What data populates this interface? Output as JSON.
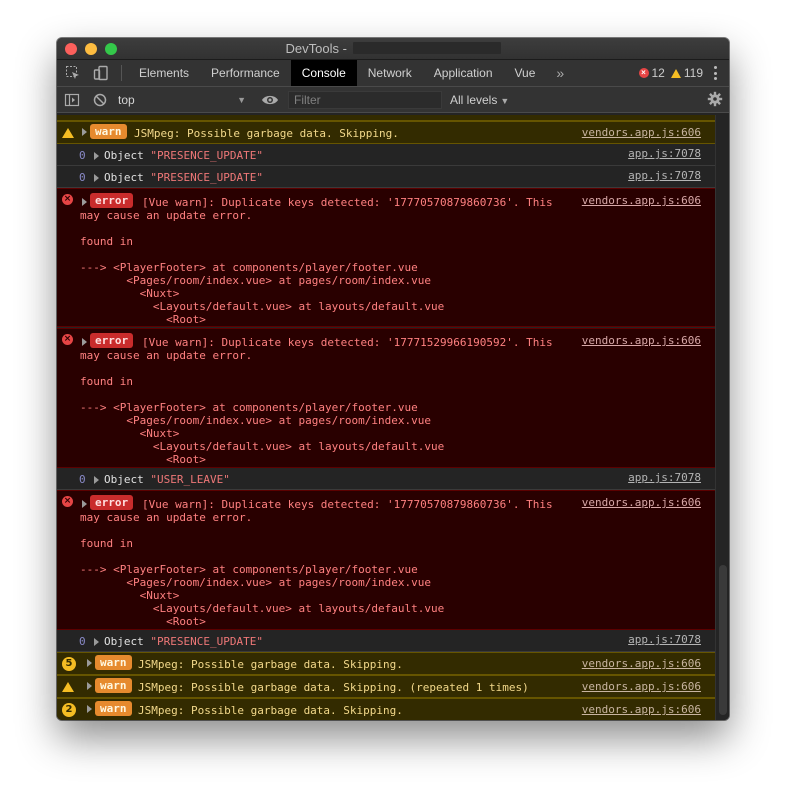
{
  "window": {
    "title": "DevTools - "
  },
  "tabs": [
    {
      "label": "Elements",
      "active": false
    },
    {
      "label": "Performance",
      "active": false
    },
    {
      "label": "Console",
      "active": true
    },
    {
      "label": "Network",
      "active": false
    },
    {
      "label": "Application",
      "active": false
    },
    {
      "label": "Vue",
      "active": false
    }
  ],
  "tabs_more": "»",
  "counts": {
    "errors": "12",
    "warnings": "119"
  },
  "toolbar": {
    "context": "top",
    "filter_placeholder": "Filter",
    "levels": "All levels"
  },
  "colors": {
    "warn_bg": "#332b00",
    "error_bg": "#290000",
    "error_accent": "#e64545",
    "warn_accent": "#f5bd23"
  },
  "messages": [
    {
      "type": "warn",
      "badge": "warn",
      "text": "JSMpeg: Possible garbage data. Skipping.",
      "source": "vendors.app.js:606"
    },
    {
      "type": "info",
      "level": "0",
      "prefix": "Object ",
      "str": "\"PRESENCE_UPDATE\"",
      "source": "app.js:7078"
    },
    {
      "type": "info",
      "level": "0",
      "prefix": "Object ",
      "str": "\"PRESENCE_UPDATE\"",
      "source": "app.js:7078"
    },
    {
      "type": "error",
      "badge": "error",
      "text": "[Vue warn]: Duplicate keys detected: '17770570879860736'. This\nmay cause an update error.\n\nfound in\n\n---> <PlayerFooter> at components/player/footer.vue\n       <Pages/room/index.vue> at pages/room/index.vue\n         <Nuxt>\n           <Layouts/default.vue> at layouts/default.vue\n             <Root>",
      "source": "vendors.app.js:606"
    },
    {
      "type": "error",
      "badge": "error",
      "text": "[Vue warn]: Duplicate keys detected: '17771529966190592'. This\nmay cause an update error.\n\nfound in\n\n---> <PlayerFooter> at components/player/footer.vue\n       <Pages/room/index.vue> at pages/room/index.vue\n         <Nuxt>\n           <Layouts/default.vue> at layouts/default.vue\n             <Root>",
      "source": "vendors.app.js:606"
    },
    {
      "type": "info",
      "level": "0",
      "prefix": "Object ",
      "str": "\"USER_LEAVE\"",
      "source": "app.js:7078"
    },
    {
      "type": "error",
      "badge": "error",
      "text": "[Vue warn]: Duplicate keys detected: '17770570879860736'. This\nmay cause an update error.\n\nfound in\n\n---> <PlayerFooter> at components/player/footer.vue\n       <Pages/room/index.vue> at pages/room/index.vue\n         <Nuxt>\n           <Layouts/default.vue> at layouts/default.vue\n             <Root>",
      "source": "vendors.app.js:606"
    },
    {
      "type": "info",
      "level": "0",
      "prefix": "Object ",
      "str": "\"PRESENCE_UPDATE\"",
      "source": "app.js:7078"
    },
    {
      "type": "warn",
      "count": "5",
      "badge": "warn",
      "text": "JSMpeg: Possible garbage data. Skipping.",
      "source": "vendors.app.js:606"
    },
    {
      "type": "warn",
      "badge": "warn",
      "text": "JSMpeg: Possible garbage data. Skipping. (repeated 1 times)",
      "source": "vendors.app.js:606"
    },
    {
      "type": "warn",
      "count": "2",
      "badge": "warn",
      "text": "JSMpeg: Possible garbage data. Skipping.",
      "source": "vendors.app.js:606"
    }
  ]
}
